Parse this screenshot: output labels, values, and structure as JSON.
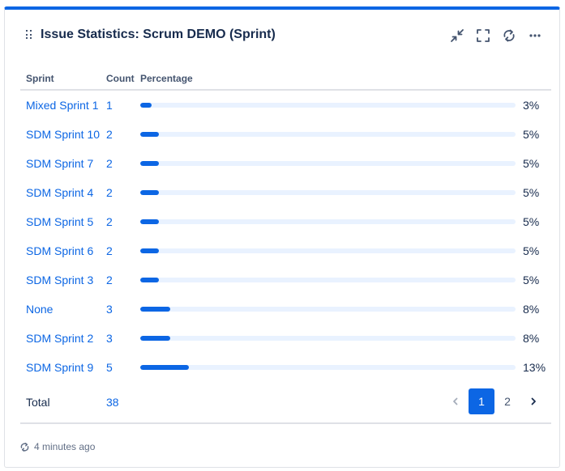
{
  "gadget": {
    "title": "Issue Statistics: Scrum DEMO (Sprint)",
    "actions": [
      "minimize-icon",
      "fullscreen-icon",
      "refresh-icon",
      "more-icon"
    ],
    "accent_color": "#0c66e4"
  },
  "table": {
    "headers": {
      "sprint": "Sprint",
      "count": "Count",
      "percentage": "Percentage"
    },
    "rows": [
      {
        "name": "Mixed Sprint 1",
        "count": "1",
        "percentage": "3%",
        "fraction": 0.03
      },
      {
        "name": "SDM Sprint 10",
        "count": "2",
        "percentage": "5%",
        "fraction": 0.05
      },
      {
        "name": "SDM Sprint 7",
        "count": "2",
        "percentage": "5%",
        "fraction": 0.05
      },
      {
        "name": "SDM Sprint 4",
        "count": "2",
        "percentage": "5%",
        "fraction": 0.05
      },
      {
        "name": "SDM Sprint 5",
        "count": "2",
        "percentage": "5%",
        "fraction": 0.05
      },
      {
        "name": "SDM Sprint 6",
        "count": "2",
        "percentage": "5%",
        "fraction": 0.05
      },
      {
        "name": "SDM Sprint 3",
        "count": "2",
        "percentage": "5%",
        "fraction": 0.05
      },
      {
        "name": "None",
        "count": "3",
        "percentage": "8%",
        "fraction": 0.08
      },
      {
        "name": "SDM Sprint 2",
        "count": "3",
        "percentage": "8%",
        "fraction": 0.08
      },
      {
        "name": "SDM Sprint 9",
        "count": "5",
        "percentage": "13%",
        "fraction": 0.13
      }
    ],
    "total_label": "Total",
    "total_count": "38"
  },
  "pagination": {
    "pages": [
      "1",
      "2"
    ],
    "current": "1",
    "prev_icon": "chevron-left-icon",
    "next_icon": "chevron-right-icon"
  },
  "footer": {
    "refresh_icon": "refresh-icon",
    "updated": "4 minutes ago"
  }
}
